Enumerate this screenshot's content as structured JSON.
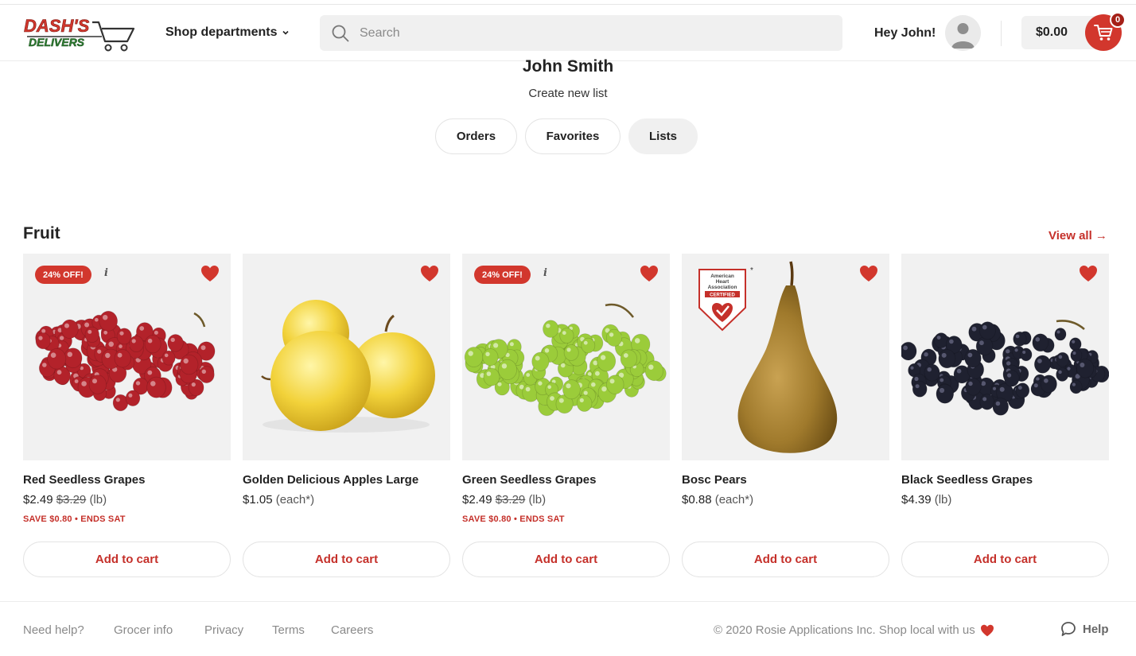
{
  "brand": {
    "logo_line1": "DASH'S",
    "logo_line2": "DELIVERS",
    "accent": "#d2372d",
    "link_red": "#c5302a",
    "logo_green": "#2e7d32"
  },
  "header": {
    "shop_departments": "Shop departments",
    "search_placeholder": "Search",
    "greeting": "Hey John!",
    "cart_total": "$0.00",
    "cart_count": "0"
  },
  "profile": {
    "name": "John Smith",
    "create_list": "Create new list",
    "tabs": [
      {
        "label": "Orders",
        "active": false
      },
      {
        "label": "Favorites",
        "active": false
      },
      {
        "label": "Lists",
        "active": true
      }
    ]
  },
  "section": {
    "title": "Fruit",
    "view_all": "View all →"
  },
  "products": [
    {
      "name": "Red Seedless Grapes",
      "price": "$2.49",
      "was": "$3.29",
      "unit": "(lb)",
      "badge": "24% OFF!",
      "info": "i",
      "save": "SAVE $0.80 • ENDS SAT",
      "button": "Add to cart",
      "image": "red-grapes",
      "favorited": true
    },
    {
      "name": "Golden Delicious Apples Large",
      "price": "$1.05",
      "was": "",
      "unit": "(each*)",
      "badge": "",
      "info": "",
      "save": "",
      "button": "Add to cart",
      "image": "golden-apples",
      "favorited": true
    },
    {
      "name": "Green Seedless Grapes",
      "price": "$2.49",
      "was": "$3.29",
      "unit": "(lb)",
      "badge": "24% OFF!",
      "info": "i",
      "save": "SAVE $0.80 • ENDS SAT",
      "button": "Add to cart",
      "image": "green-grapes",
      "favorited": true
    },
    {
      "name": "Bosc Pears",
      "price": "$0.88",
      "was": "",
      "unit": "(each*)",
      "badge": "",
      "info": "",
      "save": "",
      "button": "Add to cart",
      "image": "bosc-pear",
      "favorited": true
    },
    {
      "name": "Black Seedless Grapes",
      "price": "$4.39",
      "was": "",
      "unit": "(lb)",
      "badge": "",
      "info": "",
      "save": "",
      "button": "Add to cart",
      "image": "black-grapes",
      "favorited": true
    }
  ],
  "certification": {
    "line1": "American",
    "line2": "Heart",
    "line3": "Association",
    "line4": "CERTIFIED"
  },
  "footer": {
    "links": [
      "Need help?",
      "Grocer info",
      "Privacy",
      "Terms",
      "Careers"
    ],
    "copyright": "© 2020 Rosie Applications Inc. Shop local with us",
    "help": "Help"
  }
}
